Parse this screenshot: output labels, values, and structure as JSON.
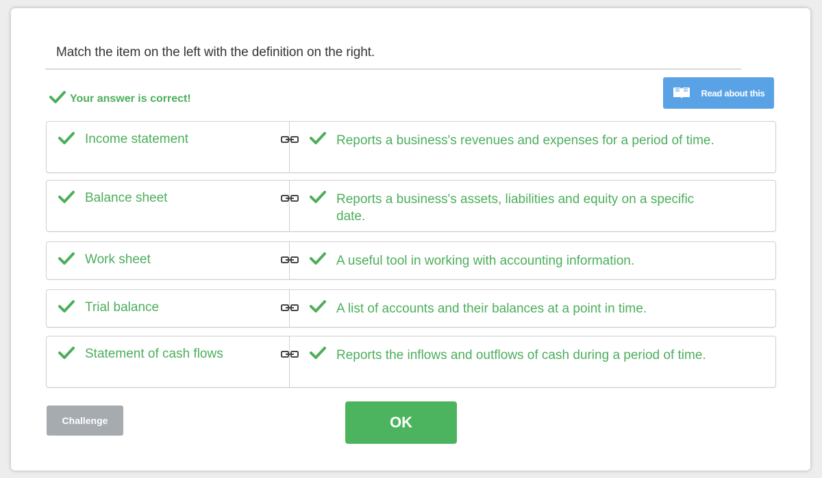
{
  "instruction": "Match the item on the left with the definition on the right.",
  "feedback": {
    "text": "Your answer is correct!",
    "icon": "checkmark-icon"
  },
  "read_button": {
    "label": "Read about this",
    "icon": "book-icon"
  },
  "pairs": [
    {
      "term": "Income statement",
      "definition": "Reports a business's revenues and expenses for a period of time."
    },
    {
      "term": "Balance sheet",
      "definition": "Reports a business's assets, liabilities and equity on a specific date."
    },
    {
      "term": "Work sheet",
      "definition": "A useful tool in working with accounting information."
    },
    {
      "term": "Trial balance",
      "definition": "A list of accounts and their balances at a point in time."
    },
    {
      "term": "Statement of cash flows",
      "definition": "Reports the inflows and outflows of cash during a period of time."
    }
  ],
  "buttons": {
    "challenge": "Challenge",
    "ok": "OK"
  },
  "colors": {
    "correct": "#4cae5b",
    "ok_button": "#4cb45e",
    "read_button": "#5aa2e6",
    "challenge_button": "#a6abb0"
  }
}
